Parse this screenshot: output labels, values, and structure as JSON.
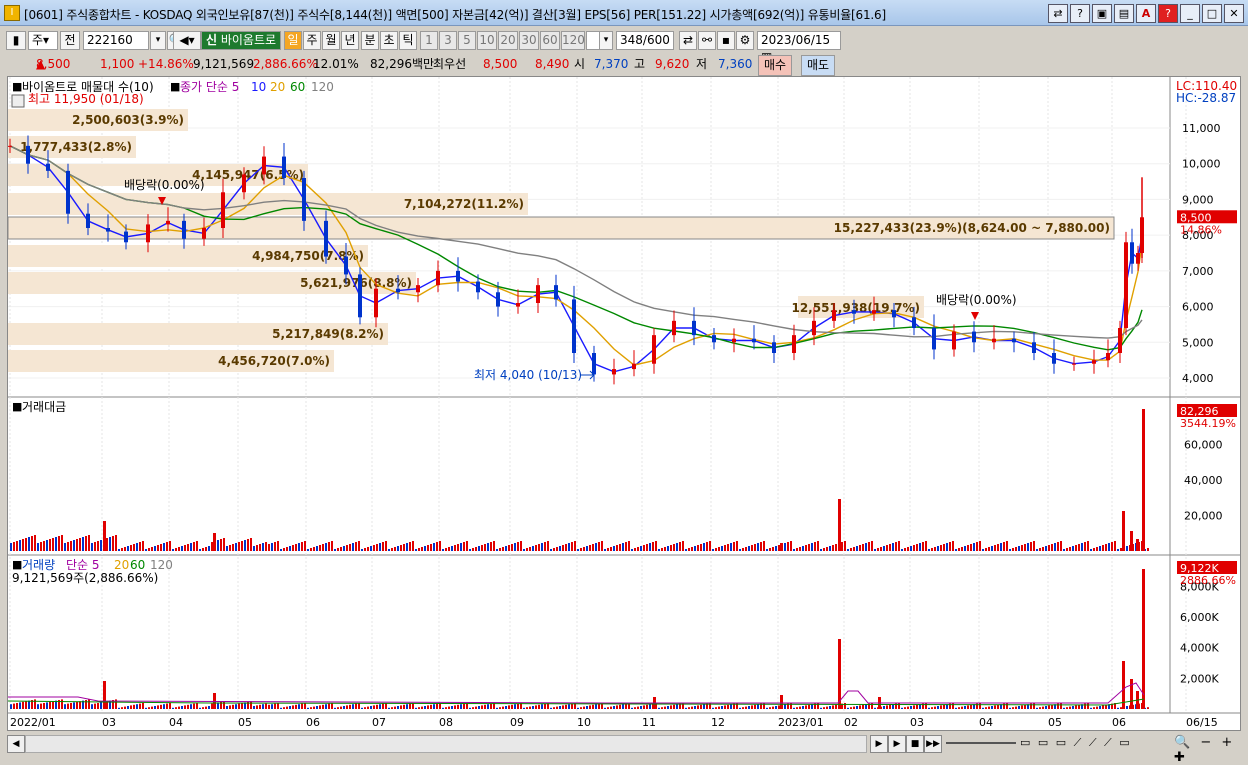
{
  "window": {
    "title": "[0601] 주식종합차트 - KOSDAQ 외국인보유[87(천)] 주식수[8,144(천)] 액면[500] 자본금[42(억)] 결산[3월] EPS[56] PER[151.22] 시가총액[692(억)] 유통비율[61.6]",
    "buttons": [
      "□",
      "?",
      "▣",
      "▤",
      "A",
      "?",
      "_",
      "□",
      "✕"
    ]
  },
  "toolbar": {
    "period": "주",
    "prev": "전",
    "code": "222160",
    "name_label": "바이옴트로",
    "tags": [
      "일",
      "주",
      "월",
      "년",
      "분",
      "초",
      "틱"
    ],
    "intervals": [
      "1",
      "3",
      "5",
      "10",
      "20",
      "30",
      "60",
      "120"
    ],
    "count": "348",
    "count_total": "/600",
    "date": "2023/06/15"
  },
  "quote": {
    "price": "8,500",
    "change": "1,100",
    "change_pct": "+14.86%",
    "volume": "9,121,569",
    "volume_pct": "2,886.66%",
    "turnover": "12.01%",
    "amount": "82,296백만",
    "best_label": "최우선",
    "ask": "8,500",
    "bid": "8,490",
    "open_label": "시",
    "open": "7,370",
    "high_label": "고",
    "high": "9,620",
    "low_label": "저",
    "low": "7,360",
    "buy": "매수",
    "sell": "매도"
  },
  "panel_price": {
    "legend_title": "바이옴트로 매물대 수(10)",
    "ma_label": "종가 단순 5",
    "ma_periods": [
      "10",
      "20",
      "60",
      "120"
    ],
    "lc": "LC:110.40",
    "hc": "HC:-28.87",
    "high_note": "최고 11,950 (01/18)",
    "low_note": "최저 4,040 (10/13)",
    "dividend_note": "배당락(0.00%)",
    "dividend_note2": "배당락(0.00%)",
    "y_ticks": [
      "11,000",
      "10,000",
      "9,000",
      "8,000",
      "7,000",
      "6,000",
      "5,000",
      "4,000"
    ],
    "current_price": "8,500",
    "current_pct": "14.86%",
    "vp_labels": [
      "2,500,603(3.9%)",
      "1,777,433(2.8%)",
      "4,145,947(6.5%)",
      "7,104,272(11.2%)",
      "15,227,433(23.9%)(8,624.00 ~ 7,880.00)",
      "4,984,750(7.8%)",
      "5,621,976(8.8%)",
      "5,217,849(8.2%)",
      "4,456,720(7.0%)",
      "12,551,938(19.7%)"
    ]
  },
  "panel_amount": {
    "title": "거래대금",
    "y_ticks": [
      "60,000",
      "40,000",
      "20,000"
    ],
    "current": "82,296",
    "current_pct": "3544.19%"
  },
  "panel_volume": {
    "title": "거래량",
    "ma_label": "단순 5",
    "ma_periods": [
      "20",
      "60",
      "120"
    ],
    "value_line": "9,121,569주(2,886.66%)",
    "y_ticks": [
      "8,000K",
      "6,000K",
      "4,000K",
      "2,000K"
    ],
    "current": "9,122K",
    "current_pct": "2886.66%"
  },
  "x_axis": [
    "2022/01",
    "03",
    "04",
    "05",
    "06",
    "07",
    "08",
    "09",
    "10",
    "11",
    "12",
    "2023/01",
    "02",
    "03",
    "04",
    "05",
    "06",
    "06/15"
  ],
  "colors": {
    "up": "#e00000",
    "down": "#0033cc",
    "ma5": "#1a1aff",
    "ma20": "#e0a000",
    "ma60": "#008800",
    "ma120": "#808080",
    "vp": "#f5e6d3"
  }
}
